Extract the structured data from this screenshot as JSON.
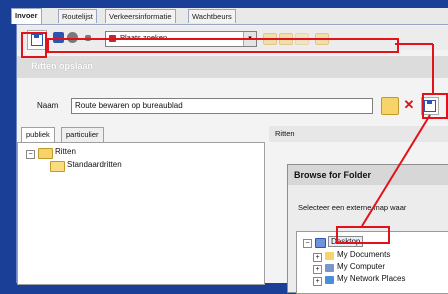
{
  "tabs": [
    "Invoer",
    "Routelijst",
    "Verkeersinformatie",
    "Wachtbeurs"
  ],
  "toolbar": {
    "place_search": "Plaats zoeken"
  },
  "dialog": {
    "title": "Ritten opslaan",
    "name_label": "Naam",
    "name_value": "Route bewaren op bureaublad",
    "pane_tabs": [
      "publiek",
      "particulier"
    ],
    "tree_root": "Ritten",
    "tree_child": "Standaardritten",
    "right_header": "Ritten"
  },
  "browse": {
    "title": "Browse for Folder",
    "description": "Selecteer een externe map waar",
    "desktop": "Desktop",
    "items": [
      "My Documents",
      "My Computer",
      "My Network Places"
    ]
  },
  "colors": {
    "annotation": "#e1121b",
    "background": "#1a3f96"
  }
}
